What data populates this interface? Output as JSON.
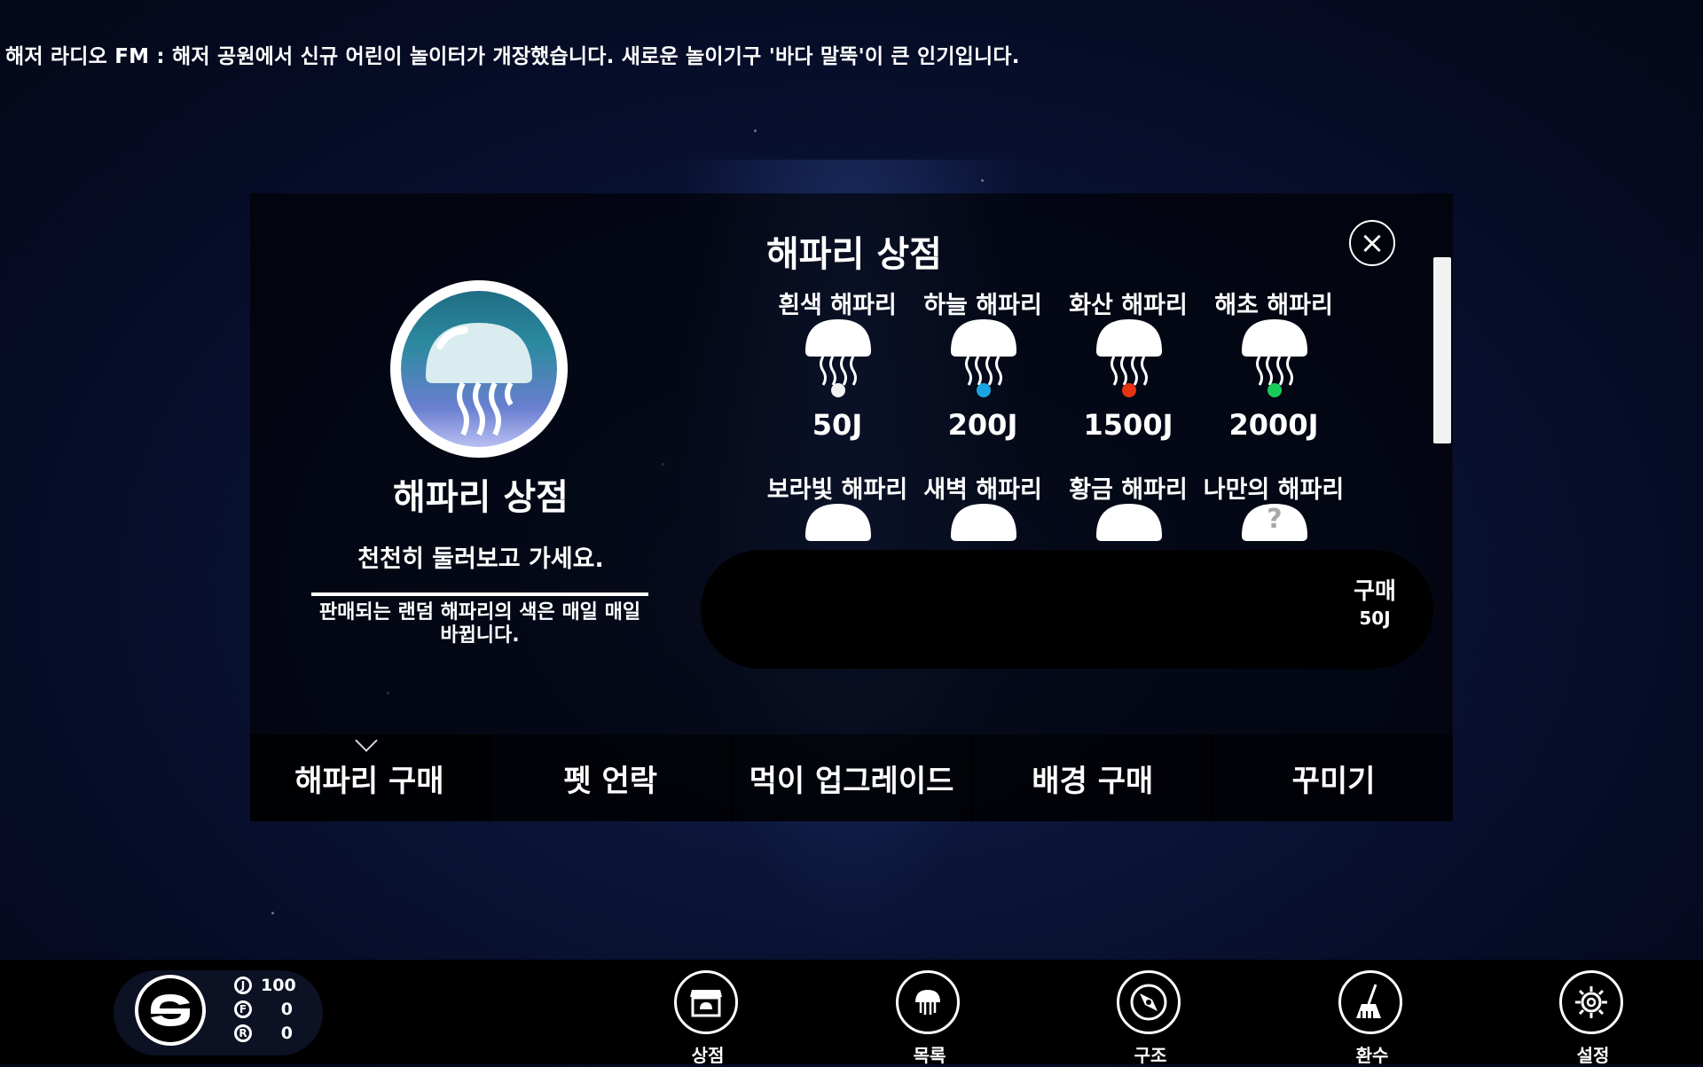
{
  "radio": {
    "text": "해저 라디오 FM : 해저 공원에서 신규 어린이 놀이터가 개장했습니다. 새로운 놀이기구 '바다 말뚝'이 큰 인기입니다."
  },
  "shop": {
    "header_title": "해파리 상점",
    "name": "해파리 상점",
    "greeting": "천천히 둘러보고 가세요.",
    "note": "판매되는 랜덤 해파리의 색은 매일 매일 바뀝니다.",
    "close_icon": "close-icon",
    "items": [
      {
        "name": "흰색 해파리",
        "price": "50J",
        "accent": "#f2f2f2"
      },
      {
        "name": "하늘 해파리",
        "price": "200J",
        "accent": "#1aa3e0"
      },
      {
        "name": "화산 해파리",
        "price": "1500J",
        "accent": "#e63312"
      },
      {
        "name": "해초 해파리",
        "price": "2000J",
        "accent": "#19cc5a"
      },
      {
        "name": "보라빛 해파리",
        "price": ""
      },
      {
        "name": "새벽 해파리",
        "price": ""
      },
      {
        "name": "황금 해파리",
        "price": ""
      },
      {
        "name": "나만의 해파리",
        "price": "",
        "mystery_mark": "?"
      }
    ],
    "buy": {
      "label": "구매",
      "price": "50J"
    }
  },
  "tabs": [
    {
      "label": "해파리 구매",
      "active": true
    },
    {
      "label": "펫 언락"
    },
    {
      "label": "먹이 업그레이드"
    },
    {
      "label": "배경 구매"
    },
    {
      "label": "꾸미기"
    }
  ],
  "status": {
    "j_icon": "J",
    "j_value": "100",
    "f_icon": "F",
    "f_value": "0",
    "r_icon": "R",
    "r_value": "0"
  },
  "nav": [
    {
      "label": "상점",
      "icon": "shop-icon"
    },
    {
      "label": "목록",
      "icon": "jellyfish-list-icon"
    },
    {
      "label": "구조",
      "icon": "compass-icon"
    },
    {
      "label": "환수",
      "icon": "broom-icon"
    },
    {
      "label": "설정",
      "icon": "gear-icon"
    }
  ]
}
